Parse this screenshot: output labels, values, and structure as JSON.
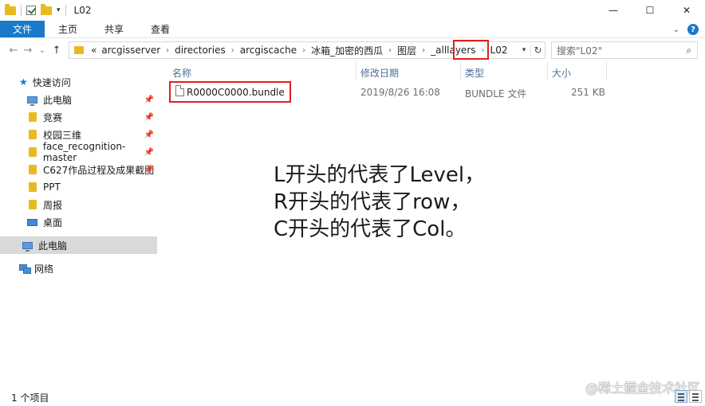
{
  "window": {
    "title": "L02",
    "controls": {
      "minimize": "—",
      "maximize": "☐",
      "close": "✕"
    }
  },
  "ribbon": {
    "tabs": [
      {
        "label": "文件",
        "active": true
      },
      {
        "label": "主页"
      },
      {
        "label": "共享"
      },
      {
        "label": "查看"
      }
    ]
  },
  "nav": {
    "back": "←",
    "forward": "→",
    "recent": "⌄",
    "up": "↑"
  },
  "address": {
    "overflow": "«",
    "crumbs": [
      "arcgisserver",
      "directories",
      "arcgiscache",
      "冰箱_加密的西瓜",
      "图层",
      "_alllayers",
      "L02"
    ]
  },
  "search": {
    "placeholder": "搜索\"L02\""
  },
  "sidebar": {
    "items": [
      {
        "label": "快速访问",
        "icon": "star-icon"
      },
      {
        "label": "此电脑",
        "icon": "pc-icon",
        "pinned": true
      },
      {
        "label": "竞赛",
        "icon": "folder-icon",
        "pinned": true
      },
      {
        "label": "校园三维",
        "icon": "folder-icon",
        "pinned": true
      },
      {
        "label": "face_recognition-master",
        "icon": "folder-icon",
        "pinned": true
      },
      {
        "label": "C627作品过程及成果截图",
        "icon": "folder-icon",
        "pinned": true
      },
      {
        "label": "PPT",
        "icon": "folder-icon"
      },
      {
        "label": "周报",
        "icon": "folder-icon"
      },
      {
        "label": "桌面",
        "icon": "desktop-icon"
      },
      {
        "label": "此电脑",
        "icon": "pc-icon",
        "selected": true
      },
      {
        "label": "网络",
        "icon": "network-icon"
      }
    ]
  },
  "columns": {
    "name": "名称",
    "date": "修改日期",
    "type": "类型",
    "size": "大小"
  },
  "files": [
    {
      "name": "R0000C0000.bundle",
      "date": "2019/8/26 16:08",
      "type": "BUNDLE 文件",
      "size": "251 KB"
    }
  ],
  "annotation": {
    "lines": [
      "L开头的代表了Level，",
      "R开头的代表了row，",
      "C开头的代表了Col。"
    ]
  },
  "watermark": "@稀土掘金技术社区",
  "status": {
    "item_count": "1 个项目"
  },
  "colors": {
    "accent": "#1979ca",
    "highlight": "#e02020",
    "folder": "#e8b923",
    "selected": "#d9d9d9"
  }
}
